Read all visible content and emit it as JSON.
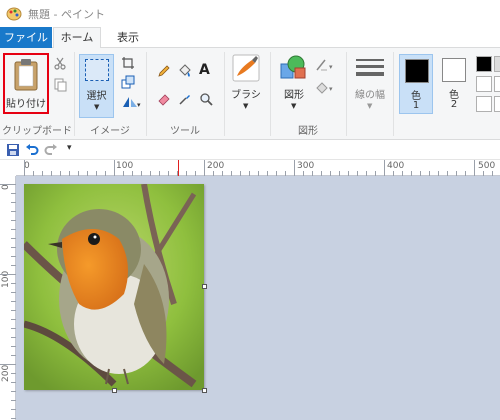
{
  "window": {
    "title": "無題 - ペイント"
  },
  "menu_tabs": {
    "file": "ファイル",
    "home": "ホーム",
    "view": "表示"
  },
  "ribbon": {
    "clipboard": {
      "paste_label": "貼り付け",
      "group_label": "クリップボード"
    },
    "image": {
      "select_label": "選択",
      "group_label": "イメージ"
    },
    "tools": {
      "group_label": "ツール"
    },
    "brushes": {
      "label": "ブラシ"
    },
    "shapes": {
      "label": "図形",
      "group_label": "図形"
    },
    "size": {
      "label": "線の幅"
    },
    "colors": {
      "color1_label": "色",
      "color1_number": "1",
      "color2_label": "色",
      "color2_number": "2",
      "color1_value": "#000000",
      "color2_value": "#ffffff"
    }
  },
  "ruler": {
    "h_labels": [
      "0",
      "100",
      "200",
      "300",
      "400",
      "500"
    ],
    "v_labels": [
      "0",
      "100",
      "200"
    ]
  },
  "colors": {
    "accent": "#1979ca",
    "paste_highlight": "#e60012",
    "canvas_background": "#c8d1e1",
    "ribbon_background": "#f5f6f7",
    "selection": "#c9e0f7"
  },
  "icons": [
    "paint-app-icon",
    "paste-clipboard-icon",
    "cut-icon",
    "copy-icon",
    "crop-icon",
    "resize-icon",
    "rotate-icon",
    "pencil-icon",
    "fill-bucket-icon",
    "text-icon",
    "eraser-icon",
    "color-picker-icon",
    "magnifier-icon",
    "brush-icon",
    "shapes-icon",
    "outline-icon",
    "fill-icon",
    "size-lines-icon",
    "save-icon",
    "undo-icon",
    "redo-icon",
    "customize-qa-icon"
  ]
}
